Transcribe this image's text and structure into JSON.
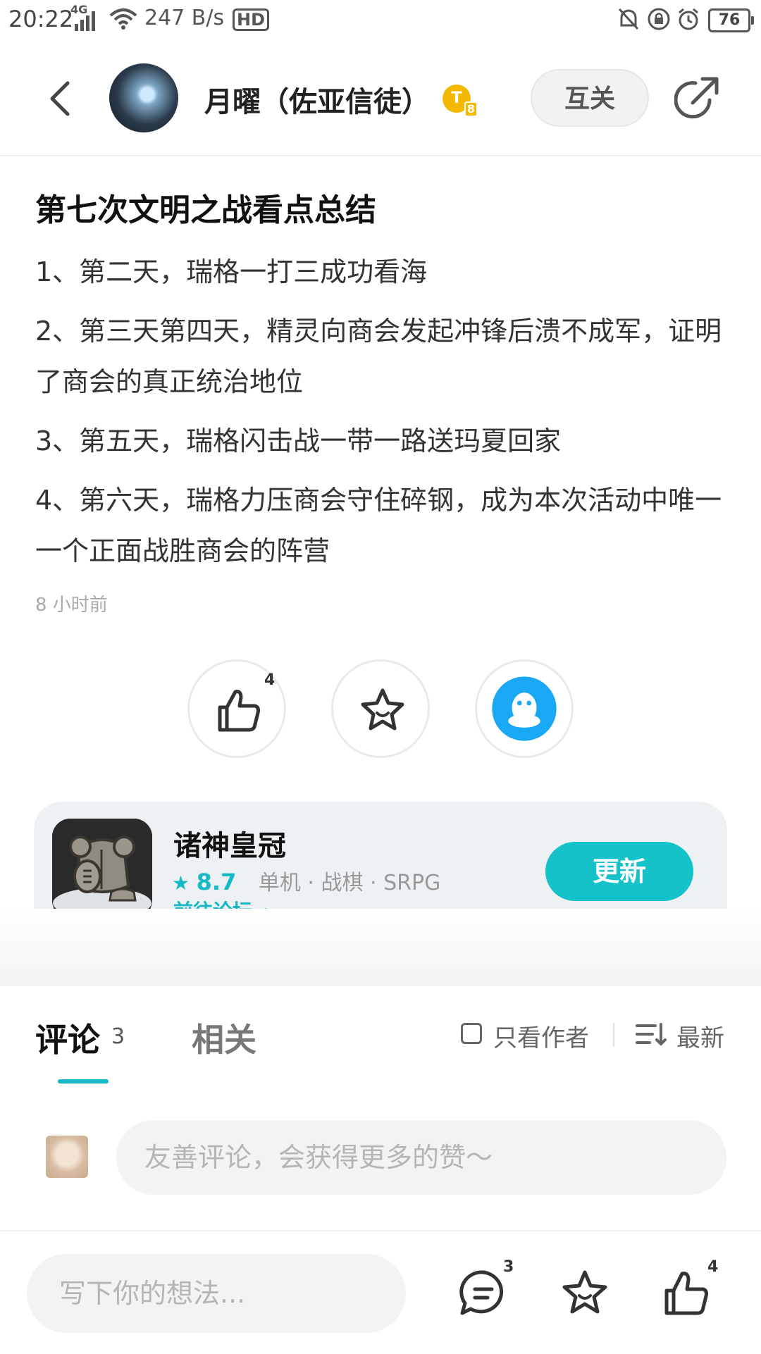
{
  "status_bar": {
    "time": "20:22",
    "network": "4G",
    "speed": "247 B/s",
    "hd": "HD",
    "battery": "76"
  },
  "header": {
    "username": "月曜（佐亚信徒）",
    "coin_label": "T",
    "coin_sub": "8",
    "follow_label": "互关"
  },
  "post": {
    "title": "第七次文明之战看点总结",
    "paragraphs": [
      "1、第二天，瑞格一打三成功看海",
      "2、第三天第四天，精灵向商会发起冲锋后溃不成军，证明了商会的真正统治地位",
      "3、第五天，瑞格闪击战一带一路送玛夏回家",
      "4、第六天，瑞格力压商会守住碎钢，成为本次活动中唯一一个正面战胜商会的阵营"
    ],
    "time_ago": "8 小时前"
  },
  "actions": {
    "like_count": "4"
  },
  "game_card": {
    "name": "诸神皇冠",
    "score": "8.7",
    "tags": "单机 · 战棋 · SRPG",
    "forum_link": "前往论坛",
    "update_label": "更新"
  },
  "tabs": {
    "comments_label": "评论",
    "comments_count": "3",
    "related_label": "相关",
    "author_only_label": "只看作者",
    "sort_label": "最新"
  },
  "comment_box": {
    "placeholder": "友善评论，会获得更多的赞～"
  },
  "bottom_bar": {
    "placeholder": "写下你的想法...",
    "comment_count": "3",
    "like_count": "4"
  },
  "colors": {
    "accent": "#17b9c7",
    "qq_blue": "#1aa8f5",
    "coin_gold": "#f5b800"
  }
}
